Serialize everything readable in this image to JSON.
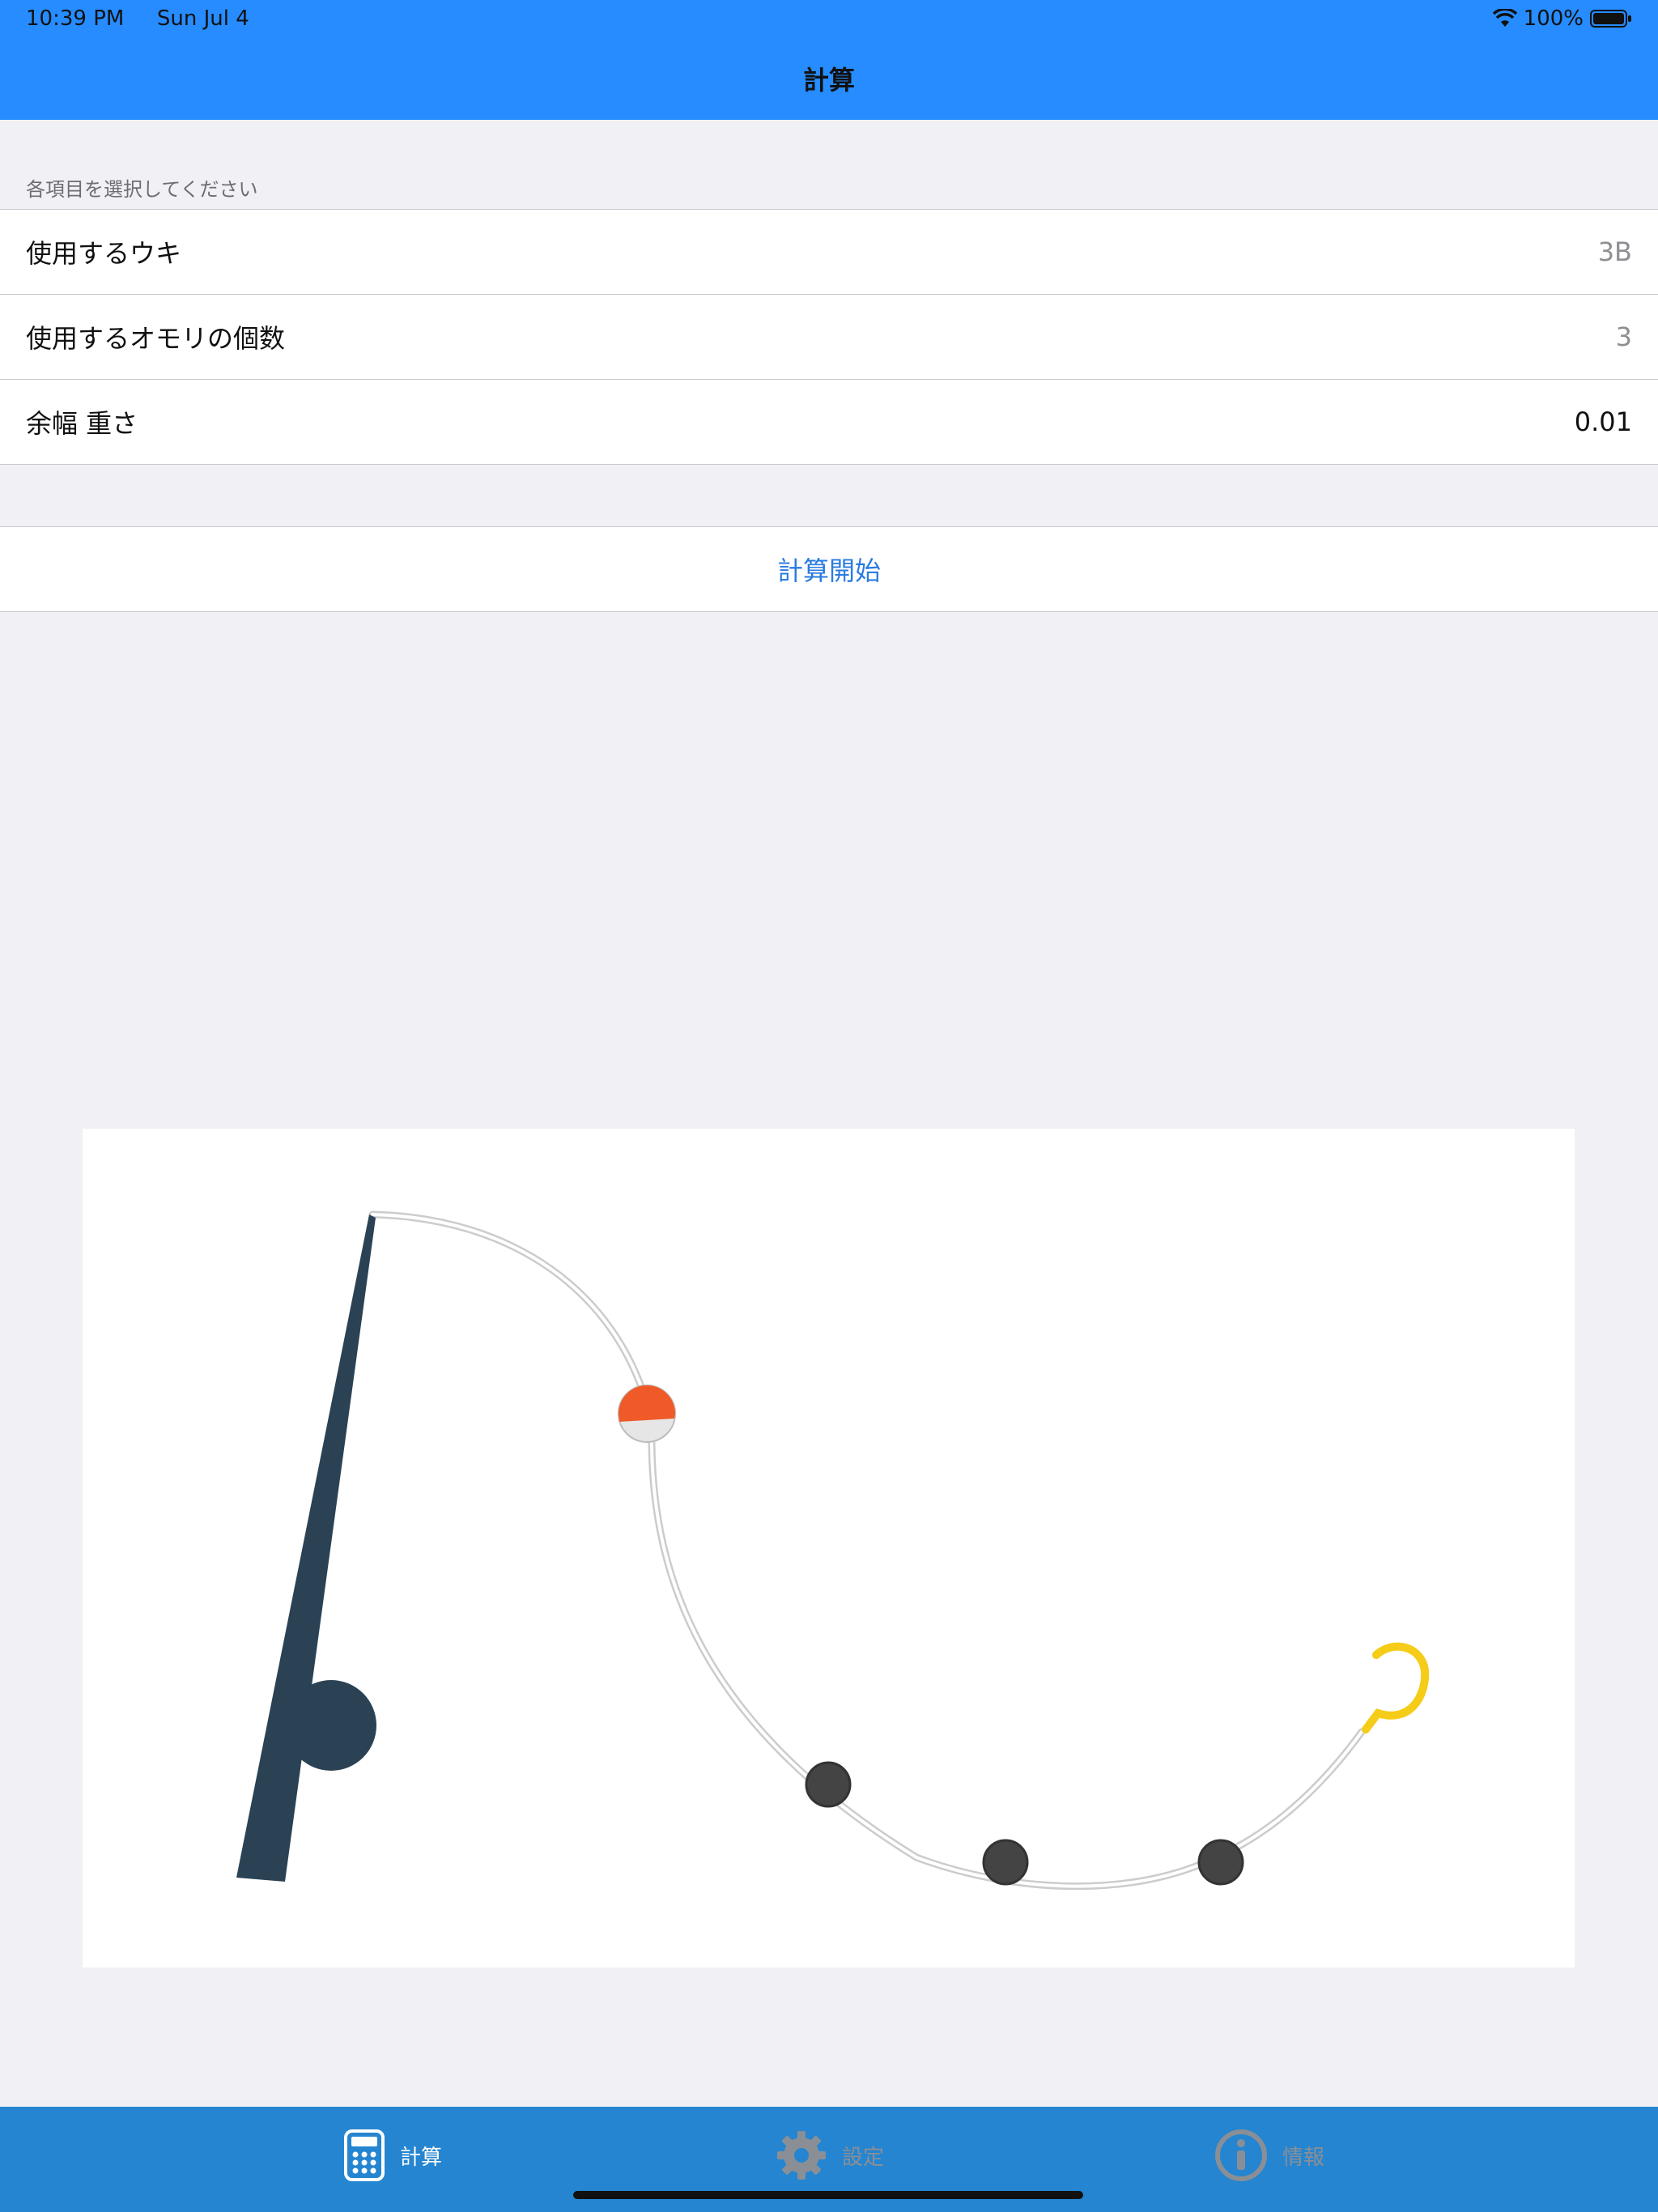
{
  "status_bar": {
    "time": "10:39 PM",
    "date": "Sun Jul 4",
    "battery": "100%"
  },
  "nav": {
    "title": "計算"
  },
  "form": {
    "section_header": "各項目を選択してください",
    "rows": [
      {
        "label": "使用するウキ",
        "value": "3B"
      },
      {
        "label": "使用するオモリの個数",
        "value": "3"
      },
      {
        "label": "余幅 重さ",
        "value": "0.01"
      }
    ],
    "start_button": "計算開始"
  },
  "illustration": {
    "rod_color": "#2a4254",
    "float_color": "#f05a28",
    "sinker_color": "#444444",
    "hook_color": "#f5cc17",
    "sinker_count": 3
  },
  "tabs": [
    {
      "label": "計算",
      "icon": "calculator-icon",
      "active": true
    },
    {
      "label": "設定",
      "icon": "gear-icon",
      "active": false
    },
    {
      "label": "情報",
      "icon": "info-icon",
      "active": false
    }
  ],
  "colors": {
    "header": "#268cff",
    "tabbar": "#2585d0",
    "link": "#2a7be0"
  }
}
